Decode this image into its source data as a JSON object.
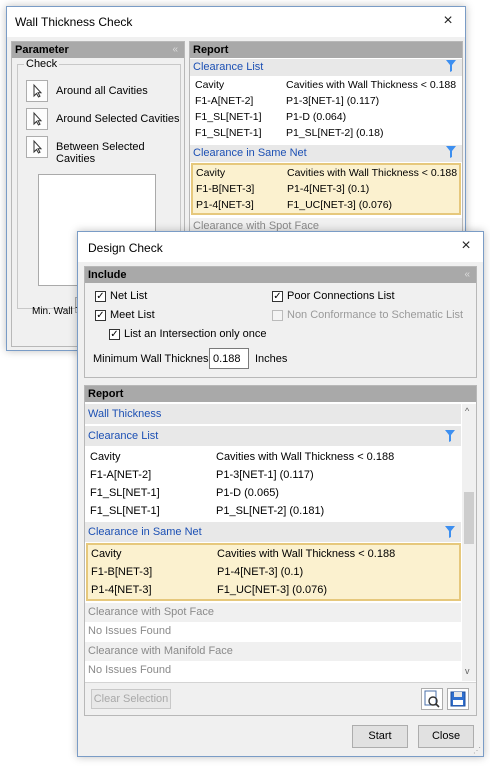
{
  "wt": {
    "title": "Wall Thickness Check",
    "close": "×",
    "parameter": {
      "header": "Parameter",
      "collapse": "«",
      "check_group": "Check",
      "buttons": [
        "Around all Cavities",
        "Around Selected Cavities",
        "Between Selected Cavities"
      ],
      "min_label": "Min. Wall Th"
    },
    "report": {
      "header": "Report",
      "clearance_list": "Clearance List",
      "col1": "Cavity",
      "col2": "Cavities with Wall Thickness < 0.188",
      "rows": [
        [
          "F1-A[NET-2]",
          "P1-3[NET-1] (0.117)"
        ],
        [
          "F1_SL[NET-1]",
          "P1-D (0.064)"
        ],
        [
          "F1_SL[NET-1]",
          "P1_SL[NET-2] (0.18)"
        ]
      ],
      "same_net": "Clearance in Same Net",
      "same_rows": [
        [
          "Cavity",
          "Cavities with Wall Thickness < 0.188"
        ],
        [
          "F1-B[NET-3]",
          "P1-4[NET-3] (0.1)"
        ],
        [
          "P1-4[NET-3]",
          "F1_UC[NET-3] (0.076)"
        ]
      ],
      "spot_face": "Clearance with Spot Face"
    }
  },
  "dc": {
    "title": "Design Check",
    "close": "×",
    "include": {
      "header": "Include",
      "collapse": "«",
      "net_list": "Net List",
      "poor_conn": "Poor Connections List",
      "meet_list": "Meet List",
      "non_conf": "Non Conformance to Schematic List",
      "intersection": "List an Intersection only once",
      "min_wall_label": "Minimum Wall Thickness",
      "min_wall_value": "0.188",
      "units": "Inches"
    },
    "report": {
      "header": "Report",
      "wall_thickness": "Wall Thickness",
      "clearance_list": "Clearance List",
      "col1": "Cavity",
      "col2": "Cavities with Wall Thickness < 0.188",
      "rows": [
        [
          "F1-A[NET-2]",
          "P1-3[NET-1] (0.117)"
        ],
        [
          "F1_SL[NET-1]",
          "P1-D (0.065)"
        ],
        [
          "F1_SL[NET-1]",
          "P1_SL[NET-2] (0.181)"
        ]
      ],
      "same_net": "Clearance in Same Net",
      "same_rows": [
        [
          "Cavity",
          "Cavities with Wall Thickness < 0.188"
        ],
        [
          "F1-B[NET-3]",
          "P1-4[NET-3] (0.1)"
        ],
        [
          "P1-4[NET-3]",
          "F1_UC[NET-3] (0.076)"
        ]
      ],
      "spot_face": "Clearance with Spot Face",
      "spot_none": "No Issues Found",
      "manifold_face": "Clearance with Manifold Face",
      "manifold_none": "No Issues Found",
      "clear_selection": "Clear Selection"
    },
    "start": "Start",
    "close_btn": "Close"
  },
  "colors": {
    "accent_text": "#1c50b4",
    "highlight_border": "#e6c87c",
    "highlight_fill": "#fbf1cf",
    "section_header": "#a9a9a9"
  },
  "icons": [
    "cursor-arrow-icon",
    "filter-funnel-icon",
    "zoom-fit-icon",
    "save-disk-icon",
    "close-icon",
    "collapse-chevrons-icon"
  ]
}
